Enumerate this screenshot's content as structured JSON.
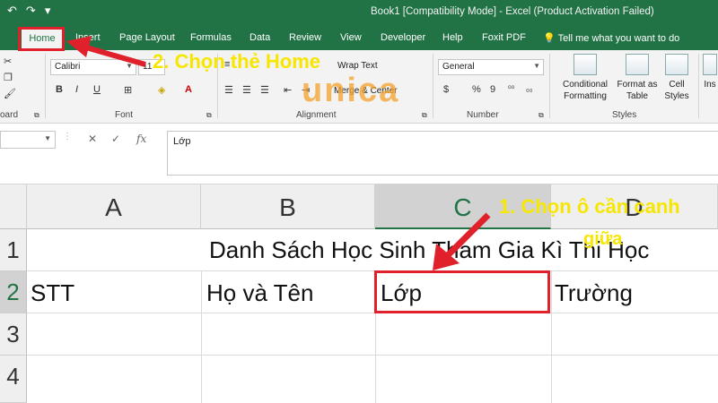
{
  "titlebar": {
    "title": "Book1  [Compatibility Mode]  -  Excel (Product Activation Failed)",
    "qat": {
      "undo": "↶",
      "redo": "↷",
      "dropdown": "▾"
    }
  },
  "tabs": [
    {
      "label": "Home",
      "active": true
    },
    {
      "label": "Insert"
    },
    {
      "label": "Page Layout"
    },
    {
      "label": "Formulas"
    },
    {
      "label": "Data"
    },
    {
      "label": "Review"
    },
    {
      "label": "View"
    },
    {
      "label": "Developer"
    },
    {
      "label": "Help"
    },
    {
      "label": "Foxit PDF"
    }
  ],
  "tellme": "Tell me what you want to do",
  "ribbon": {
    "clipboard_label": "oard",
    "font": {
      "name": "Calibri",
      "size": "11",
      "label": "Font"
    },
    "alignment": {
      "wrap_text": "Wrap Text",
      "merge_center": "Merge & Center",
      "label": "Alignment"
    },
    "number": {
      "format": "General",
      "currency": "$",
      "percent": "%",
      "comma": "9",
      "label": "Number"
    },
    "styles": {
      "conditional": "Conditional",
      "conditional2": "Formatting",
      "format_as": "Format as",
      "format_as2": "Table",
      "cell": "Cell",
      "cell2": "Styles",
      "label": "Styles"
    },
    "insert_cut": "Ins"
  },
  "formula_bar": {
    "fx": "fx",
    "cancel": "✕",
    "enter": "✓",
    "content": "Lớp"
  },
  "sheet": {
    "columns": [
      "A",
      "B",
      "C",
      "D"
    ],
    "rows": [
      "1",
      "2",
      "3",
      "4"
    ],
    "row1_title": "Danh Sách Học Sinh Tham Gia Kì Thi Học",
    "row2": {
      "a": "STT",
      "b": "Họ và Tên",
      "c": "Lớp",
      "d": "Trường"
    }
  },
  "annotations": {
    "step2": "2. Chọn thẻ Home",
    "step1_line1": "1. Chọn ô cần canh",
    "step1_line2": "giữa",
    "logo": "unica"
  },
  "colors": {
    "excel_green": "#217346",
    "annotation_yellow": "#f7e600",
    "highlight_red": "#e0202a"
  }
}
